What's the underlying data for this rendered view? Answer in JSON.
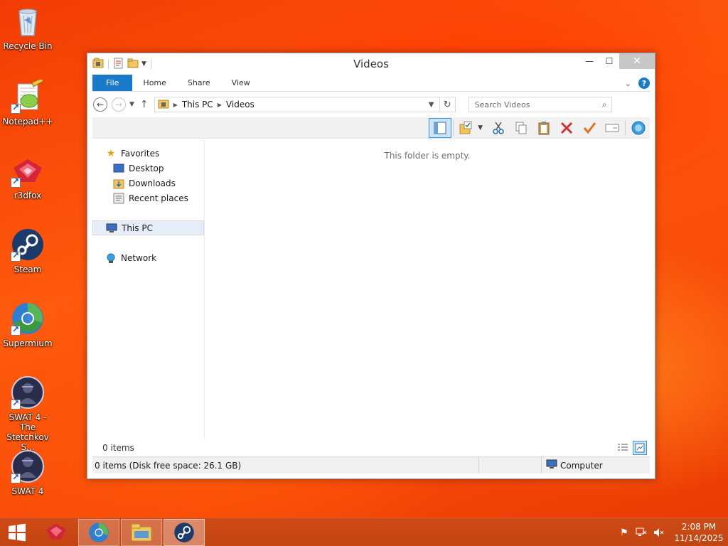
{
  "desktop": {
    "icons": [
      {
        "label": "Recycle Bin"
      },
      {
        "label": "Notepad++"
      },
      {
        "label": "r3dfox"
      },
      {
        "label": "Steam"
      },
      {
        "label": "Supermium"
      },
      {
        "label": "SWAT 4 - The Stetchkov S..."
      },
      {
        "label": "SWAT 4"
      }
    ]
  },
  "window": {
    "title": "Videos",
    "controls": {
      "minimize": "—",
      "maximize": "☐",
      "close": "✕"
    },
    "ribbon_tabs": [
      "File",
      "Home",
      "Share",
      "View"
    ],
    "address": {
      "crumbs": [
        "This PC",
        "Videos"
      ]
    },
    "search": {
      "placeholder": "Search Videos"
    },
    "nav_pane": {
      "favorites": "Favorites",
      "favorites_items": [
        "Desktop",
        "Downloads",
        "Recent places"
      ],
      "this_pc": "This PC",
      "network": "Network"
    },
    "main": {
      "empty_message": "This folder is empty."
    },
    "items_count": "0 items",
    "status": {
      "left": "0 items (Disk free space: 26.1 GB)",
      "right": "Computer"
    }
  },
  "taskbar": {
    "clock_time": "2:08 PM",
    "clock_date": "11/14/2025"
  },
  "colors": {
    "accent": "#1979ca",
    "desktop": "#f24a08",
    "taskbar": "#c84714"
  }
}
